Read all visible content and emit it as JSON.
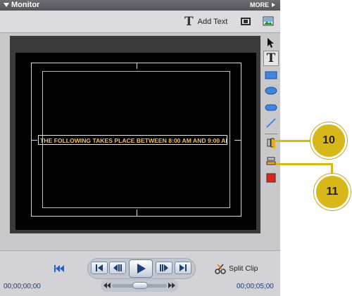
{
  "panel": {
    "title": "Monitor",
    "more_label": "MORE"
  },
  "toolbar": {
    "add_text_label": "Add Text",
    "icons": [
      "text-t-icon",
      "snapshot-icon",
      "image-icon"
    ]
  },
  "canvas": {
    "title_text": "THE FOLLOWING TAKES PLACE BETWEEN 8:00 AM AND 9:00 AM"
  },
  "tools": [
    "pointer-icon",
    "text-tool-icon",
    "rectangle-icon",
    "ellipse-icon",
    "rounded-rect-icon",
    "line-icon",
    "align-vertical-icon",
    "align-horizontal-icon",
    "fill-color-icon"
  ],
  "playback": {
    "split_clip_label": "Split Clip",
    "start_timecode": "00;00;00;00",
    "end_timecode": "00;00;05;00"
  },
  "callouts": {
    "first": "10",
    "second": "11"
  },
  "colors": {
    "title_bar": "#5f5f65",
    "text_color": "#f0c060",
    "callout": "#d7b719"
  }
}
